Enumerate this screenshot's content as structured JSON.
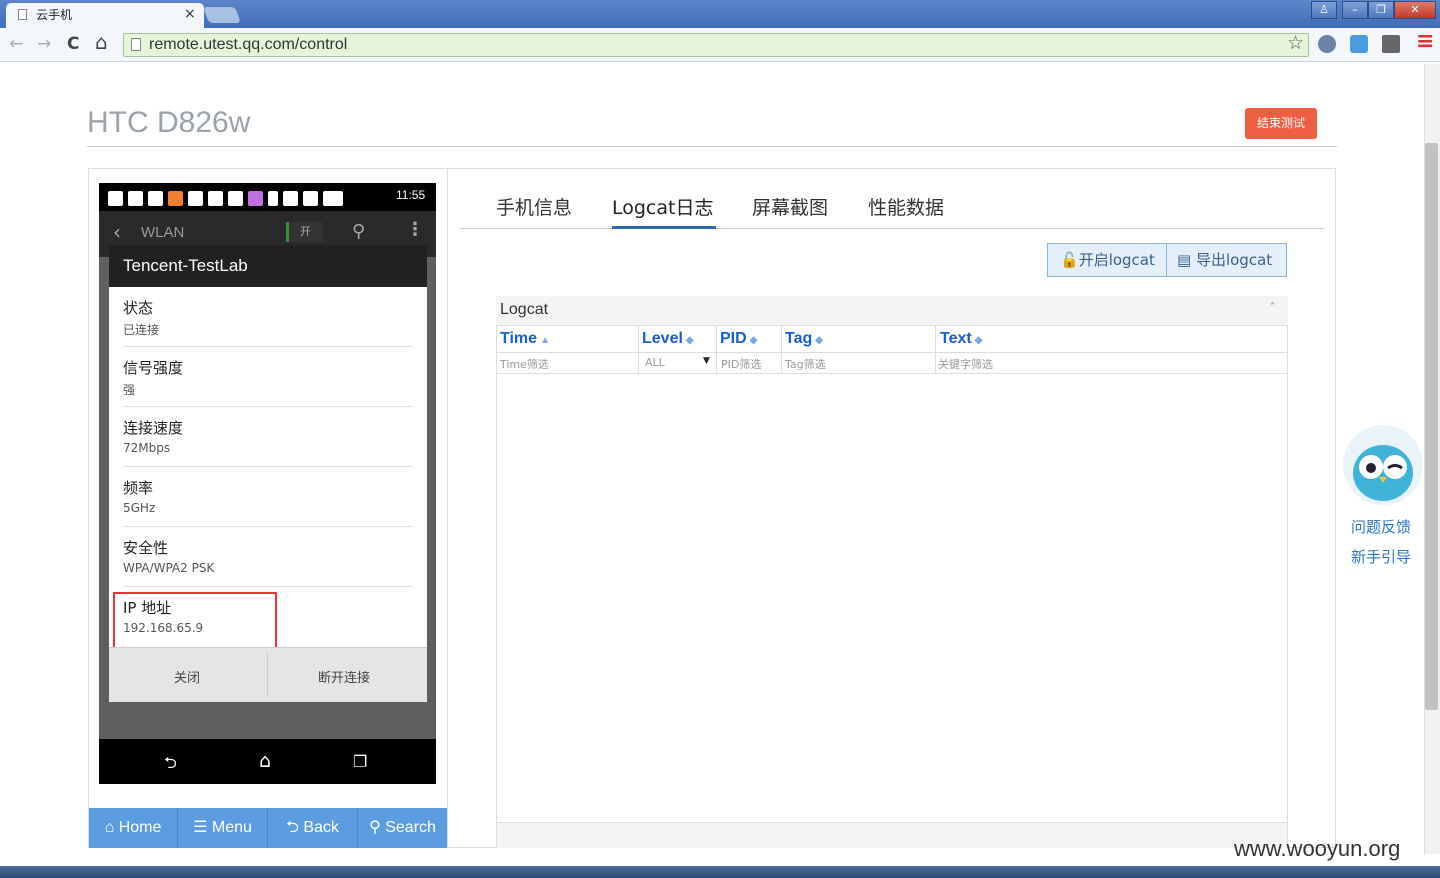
{
  "browser": {
    "tab_title": "云手机",
    "tab_close": "×",
    "url": "remote.utest.qq.com/control",
    "win_user": "♙",
    "win_minimize": "–",
    "win_restore": "❐",
    "win_close": "✕",
    "nav_back": "←",
    "nav_forward": "→",
    "nav_reload": "C",
    "nav_home": "⌂",
    "star": "☆",
    "menu": "≡"
  },
  "header": {
    "device_name": "HTC D826w",
    "end_test_label": "结束测试"
  },
  "phone": {
    "time": "11:55",
    "wlan_title": "WLAN",
    "wlan_toggle": "开",
    "dialog_title": "Tencent-TestLab",
    "rows": [
      {
        "label": "状态",
        "value": "已连接"
      },
      {
        "label": "信号强度",
        "value": "强"
      },
      {
        "label": "连接速度",
        "value": "72Mbps"
      },
      {
        "label": "频率",
        "value": "5GHz"
      },
      {
        "label": "安全性",
        "value": "WPA/WPA2 PSK"
      },
      {
        "label": "IP 地址",
        "value": "192.168.65.9"
      }
    ],
    "btn_close": "关闭",
    "btn_disconnect": "断开连接",
    "nav_back": "⮌",
    "nav_home": "⌂",
    "nav_recent": "❐"
  },
  "controls": {
    "home": "Home",
    "menu": "Menu",
    "back": "Back",
    "search": "Search"
  },
  "tabs": [
    "手机信息",
    "Logcat日志",
    "屏幕截图",
    "性能数据"
  ],
  "logcat_buttons": {
    "start": "开启logcat",
    "export": "导出logcat"
  },
  "logcat": {
    "title": "Logcat",
    "collapse": "˄",
    "columns": [
      {
        "header": "Time",
        "filter": "Time筛选"
      },
      {
        "header": "Level",
        "filter": "ALL"
      },
      {
        "header": "PID",
        "filter": "PID筛选"
      },
      {
        "header": "Tag",
        "filter": "Tag筛选"
      },
      {
        "header": "Text",
        "filter": "关键字筛选"
      }
    ]
  },
  "side": {
    "feedback": "问题反馈",
    "guide": "新手引导"
  },
  "watermark": "www.wooyun.org"
}
